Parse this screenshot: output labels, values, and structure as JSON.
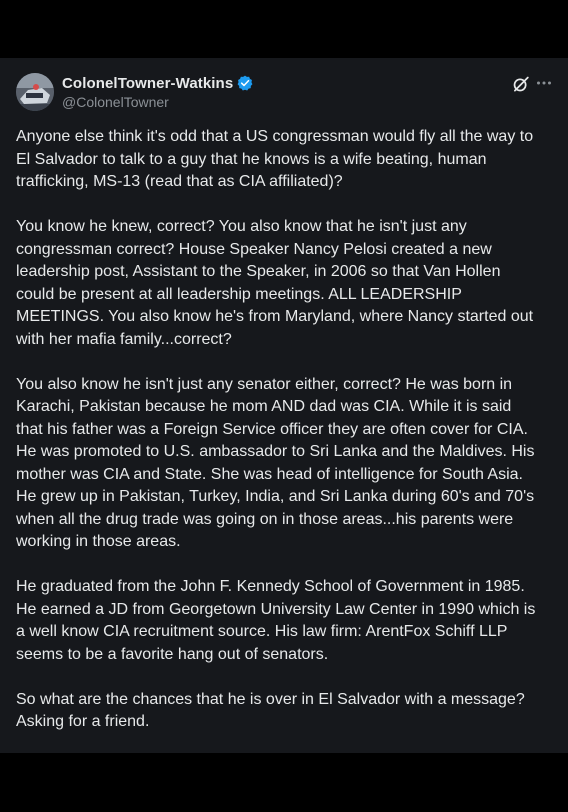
{
  "post": {
    "author": {
      "display_name": "ColonelTowner-Watkins",
      "handle": "@ColonelTowner",
      "verified": true,
      "avatar_icon": "avatar-image"
    },
    "icons": {
      "grok": "grok-icon",
      "more": "more-options-icon"
    },
    "colors": {
      "background": "#16181c",
      "text": "#e7e9ea",
      "handle": "#8b9096",
      "verified_badge": "#1d9bf0"
    },
    "paragraphs": [
      [
        "Anyone else think it's odd that a US congressman would fly all the way to",
        "El Salvador to talk to a guy that he knows is a wife beating, human",
        "trafficking, MS-13 (read that as CIA affiliated)?"
      ],
      [
        "You know he knew, correct? You also know that he isn't just any",
        "congressman correct? House Speaker Nancy Pelosi created a new",
        "leadership post, Assistant to the Speaker, in 2006 so that Van Hollen",
        "could be present at all leadership meetings. ALL LEADERSHIP",
        "MEETINGS. You also know he's from Maryland, where Nancy started out",
        "with her mafia family...correct?"
      ],
      [
        "You also know he isn't just any senator either, correct? He was born in",
        "Karachi, Pakistan because he mom AND dad was CIA.  While it is said",
        "that his father was a Foreign Service officer they are often cover for CIA.",
        "He was promoted to U.S. ambassador to Sri Lanka and the Maldives. His",
        "mother was CIA and State. She was head of intelligence  for South Asia.",
        "He grew up in Pakistan, Turkey, India, and Sri Lanka during 60's and 70's",
        "when all the drug trade was going on in those areas...his parents were",
        "working in those areas."
      ],
      [
        "He graduated from the John F. Kennedy School of Government in 1985.",
        "He earned a JD from Georgetown University Law Center in 1990 which is",
        "a well know CIA recruitment source. His law firm: ArentFox Schiff LLP",
        "seems to be a favorite hang out of senators."
      ],
      [
        "So what are the chances that he is over in El Salvador with a message?",
        "Asking for a friend."
      ]
    ]
  }
}
